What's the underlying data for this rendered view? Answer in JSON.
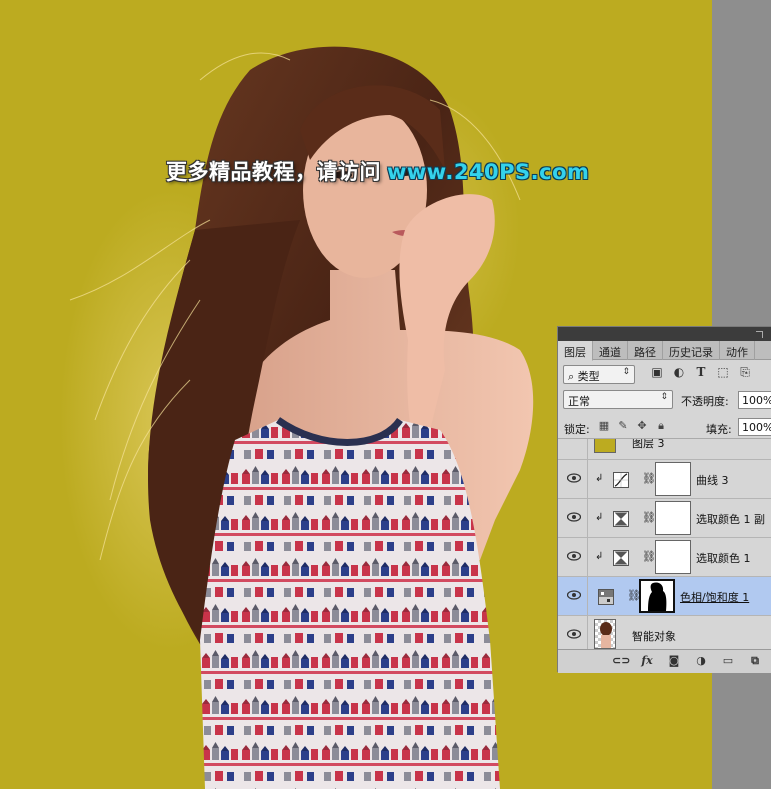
{
  "watermark": {
    "text_cn": "更多精品教程，请访问",
    "text_url": "www.240PS.com"
  },
  "colors": {
    "canvas_background": "#bcab20",
    "watermark_url": "#34d2ec",
    "selected_layer": "#b1c9f0"
  },
  "layers_panel": {
    "tabs": [
      "图层",
      "通道",
      "路径",
      "历史记录",
      "动作"
    ],
    "active_tab": "图层",
    "filter": {
      "icon": "search-icon",
      "label": "类型"
    },
    "blend_mode": "正常",
    "opacity_label": "不透明度:",
    "opacity_value": "100%",
    "lock_label": "锁定:",
    "fill_label": "填充:",
    "fill_value": "100%",
    "layers": [
      {
        "name": "图层 3",
        "type": "pixel",
        "partially_visible": true
      },
      {
        "name": "曲线 3",
        "type": "curves",
        "icon": "curves-icon",
        "clipped": true
      },
      {
        "name": "选取颜色 1 副",
        "type": "selective-color",
        "icon": "selective-color-icon",
        "clipped": true
      },
      {
        "name": "选取颜色 1",
        "type": "selective-color",
        "icon": "selective-color-icon",
        "clipped": true
      },
      {
        "name": "色相/饱和度 1",
        "type": "hue-saturation",
        "icon": "hue-saturation-icon",
        "selected": true
      },
      {
        "name": "智能对象",
        "type": "smart-object",
        "icon": "smart-object-icon"
      }
    ],
    "footer_icons": [
      "link-layers-icon",
      "fx-icon",
      "add-mask-icon",
      "adjustment-icon",
      "group-icon",
      "new-layer-icon"
    ]
  }
}
